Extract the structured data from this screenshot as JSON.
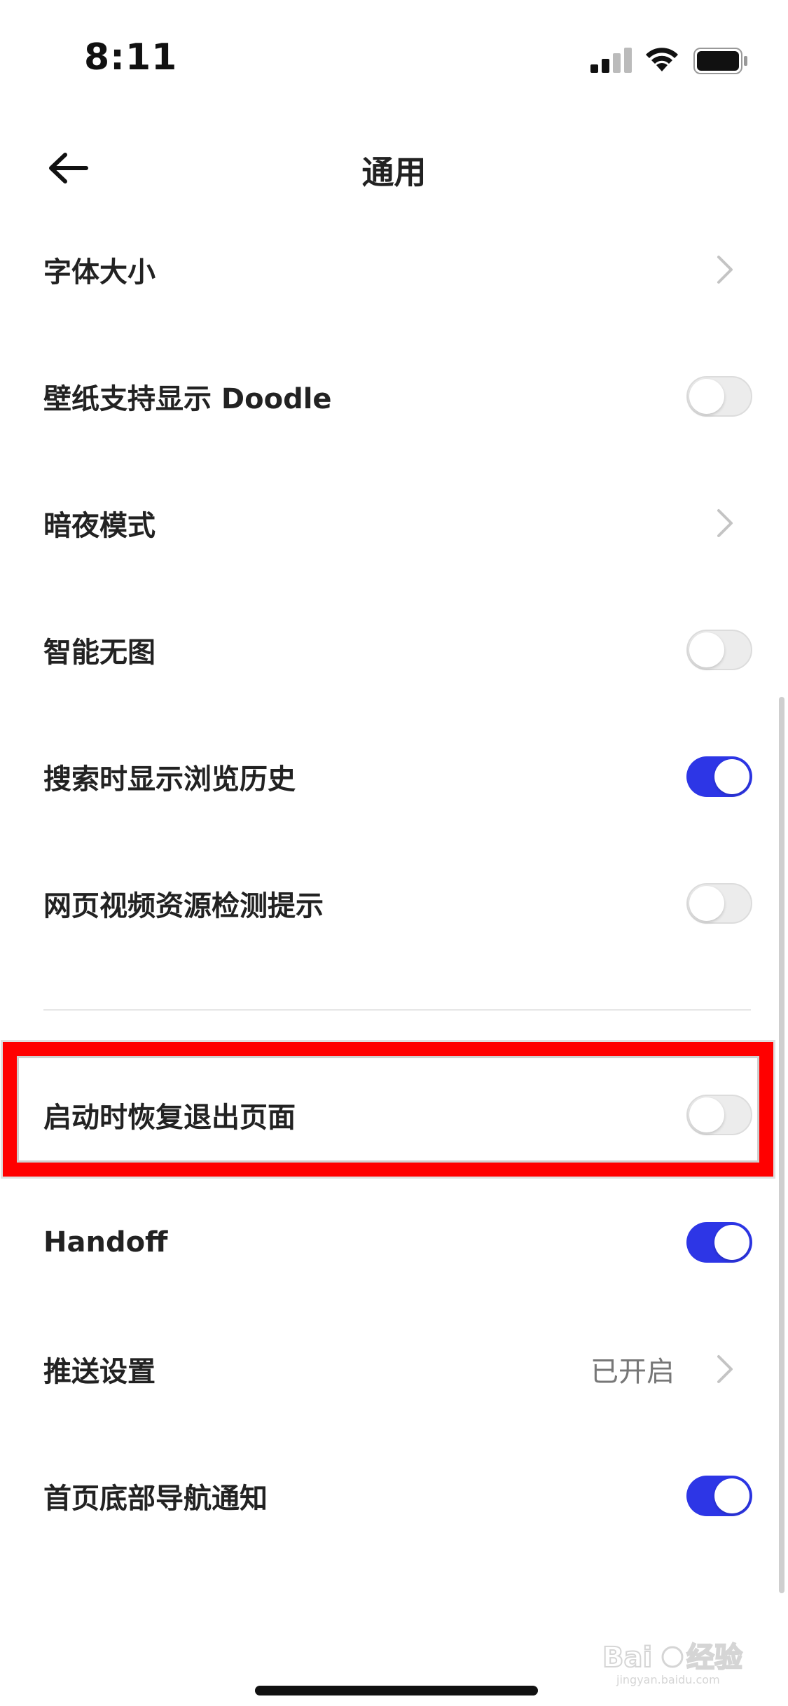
{
  "status_bar": {
    "time": "8:11",
    "icons": [
      "cellular-signal-icon",
      "wifi-icon",
      "battery-icon"
    ]
  },
  "nav": {
    "back_icon": "arrow-left-icon",
    "title": "通用"
  },
  "settings": [
    {
      "label": "字体大小",
      "control": "chevron"
    },
    {
      "label": "壁纸支持显示 Doodle",
      "control": "toggle",
      "on": false
    },
    {
      "label": "暗夜模式",
      "control": "chevron"
    },
    {
      "label": "智能无图",
      "control": "toggle",
      "on": false
    },
    {
      "label": "搜索时显示浏览历史",
      "control": "toggle",
      "on": true
    },
    {
      "label": "网页视频资源检测提示",
      "control": "toggle",
      "on": false
    },
    {
      "label": "启动时恢复退出页面",
      "control": "toggle",
      "on": false,
      "highlighted": true
    },
    {
      "label": "Handoff",
      "control": "toggle",
      "on": true
    },
    {
      "label": "推送设置",
      "control": "chevron",
      "value": "已开启"
    },
    {
      "label": "首页底部导航通知",
      "control": "toggle",
      "on": true
    }
  ],
  "colors": {
    "toggle_on": "#2d36e6",
    "toggle_off": "#ececec",
    "highlight": "#ff0000",
    "text": "#222222",
    "secondary_text": "#777777"
  },
  "watermark": {
    "text": "Bai du 经验",
    "subtext": "jingyan.baidu.com"
  }
}
